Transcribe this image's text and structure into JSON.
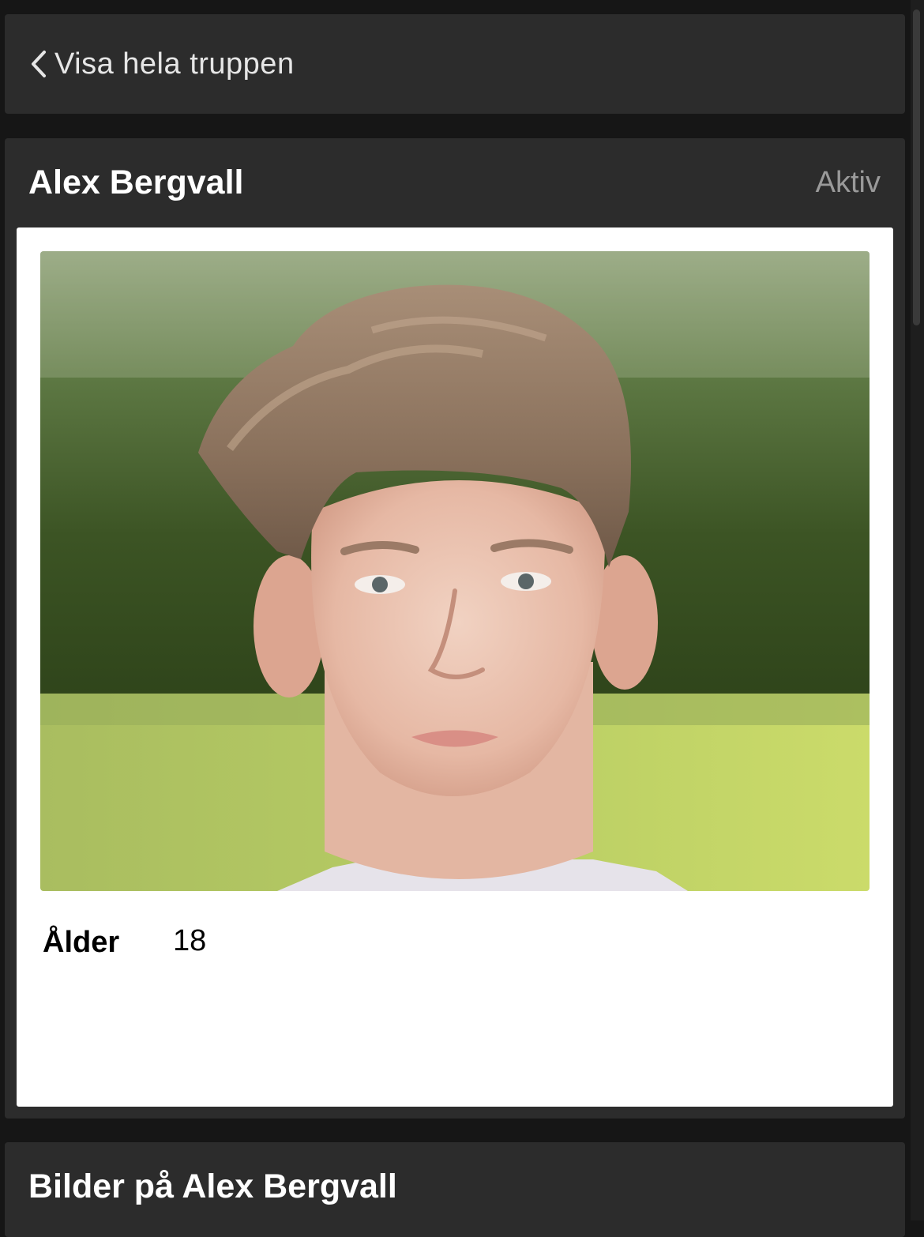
{
  "nav": {
    "back_label": "Visa hela truppen",
    "back_icon": "chevron-left-icon"
  },
  "player": {
    "name": "Alex Bergvall",
    "status": "Aktiv",
    "photo": "player-portrait",
    "facts": [
      {
        "label": "Ålder",
        "value": "18"
      }
    ]
  },
  "gallery": {
    "title": "Bilder på Alex Bergvall"
  },
  "colors": {
    "page_background": "#161616",
    "panel_background": "#2c2c2c",
    "card_background": "#ffffff",
    "status_text": "#9a9a9a"
  }
}
